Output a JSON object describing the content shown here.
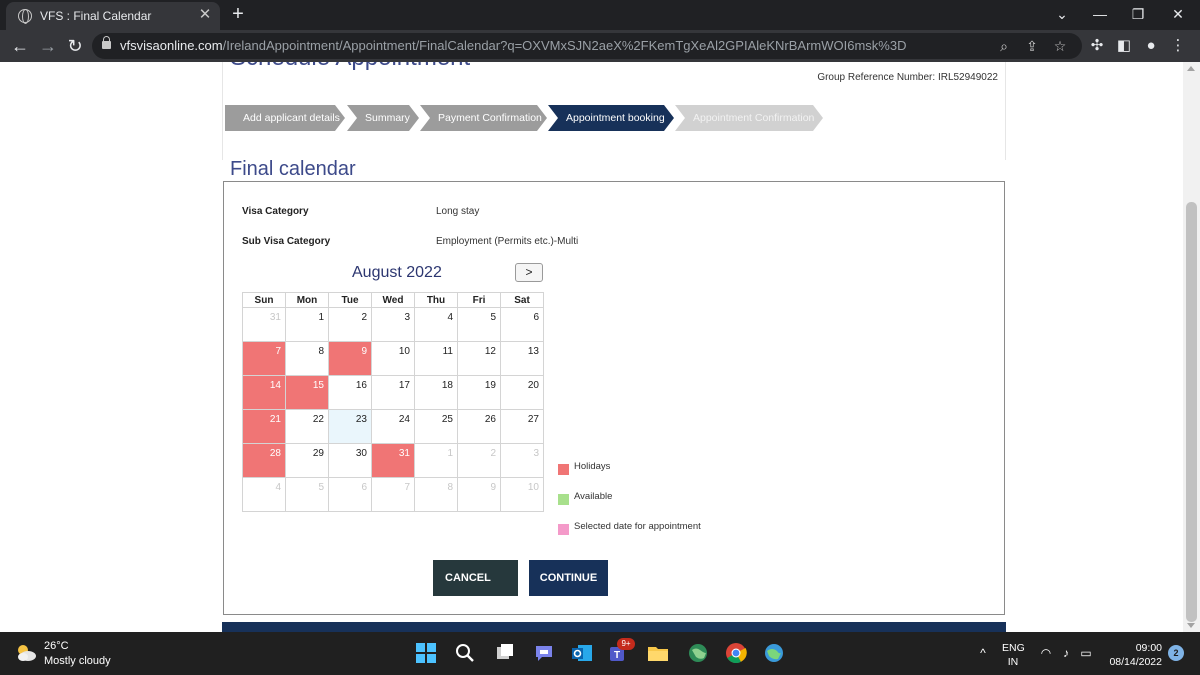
{
  "browser": {
    "tab_title": "VFS : Final Calendar",
    "tab_close": "✕",
    "new_tab": "+",
    "url_host": "vfsvisaonline.com",
    "url_path": "/IrelandAppointment/Appointment/FinalCalendar?q=OXVMxSJN2aeX%2FKemTgXeAl2GPIAleKNrBArmWOI6msk%3D"
  },
  "page": {
    "heading_partial": "Schedule Appointment",
    "group_reference": "Group Reference Number: IRL52949022",
    "steps": [
      {
        "label": "Add applicant details",
        "state": "done"
      },
      {
        "label": "Summary",
        "state": "done"
      },
      {
        "label": "Payment Confirmation",
        "state": "done"
      },
      {
        "label": "Appointment booking",
        "state": "active"
      },
      {
        "label": "Appointment Confirmation",
        "state": "pending"
      }
    ],
    "section_title": "Final calendar",
    "visa_category_label": "Visa Category",
    "visa_category_value": "Long stay",
    "sub_visa_category_label": "Sub Visa Category",
    "sub_visa_category_value": "Employment (Permits etc.)-Multi"
  },
  "calendar": {
    "month_title": "August 2022",
    "next_button": ">",
    "weekdays": [
      "Sun",
      "Mon",
      "Tue",
      "Wed",
      "Thu",
      "Fri",
      "Sat"
    ],
    "weeks": [
      [
        {
          "d": "31",
          "t": "other"
        },
        {
          "d": "1",
          "t": ""
        },
        {
          "d": "2",
          "t": ""
        },
        {
          "d": "3",
          "t": ""
        },
        {
          "d": "4",
          "t": ""
        },
        {
          "d": "5",
          "t": ""
        },
        {
          "d": "6",
          "t": ""
        }
      ],
      [
        {
          "d": "7",
          "t": "holiday"
        },
        {
          "d": "8",
          "t": ""
        },
        {
          "d": "9",
          "t": "holiday"
        },
        {
          "d": "10",
          "t": ""
        },
        {
          "d": "11",
          "t": ""
        },
        {
          "d": "12",
          "t": ""
        },
        {
          "d": "13",
          "t": ""
        }
      ],
      [
        {
          "d": "14",
          "t": "holiday"
        },
        {
          "d": "15",
          "t": "holiday"
        },
        {
          "d": "16",
          "t": ""
        },
        {
          "d": "17",
          "t": ""
        },
        {
          "d": "18",
          "t": ""
        },
        {
          "d": "19",
          "t": ""
        },
        {
          "d": "20",
          "t": ""
        }
      ],
      [
        {
          "d": "21",
          "t": "holiday"
        },
        {
          "d": "22",
          "t": ""
        },
        {
          "d": "23",
          "t": "today"
        },
        {
          "d": "24",
          "t": ""
        },
        {
          "d": "25",
          "t": ""
        },
        {
          "d": "26",
          "t": ""
        },
        {
          "d": "27",
          "t": ""
        }
      ],
      [
        {
          "d": "28",
          "t": "holiday"
        },
        {
          "d": "29",
          "t": ""
        },
        {
          "d": "30",
          "t": ""
        },
        {
          "d": "31",
          "t": "holiday"
        },
        {
          "d": "1",
          "t": "other"
        },
        {
          "d": "2",
          "t": "other"
        },
        {
          "d": "3",
          "t": "other"
        }
      ],
      [
        {
          "d": "4",
          "t": "other"
        },
        {
          "d": "5",
          "t": "other"
        },
        {
          "d": "6",
          "t": "other"
        },
        {
          "d": "7",
          "t": "other"
        },
        {
          "d": "8",
          "t": "other"
        },
        {
          "d": "9",
          "t": "other"
        },
        {
          "d": "10",
          "t": "other"
        }
      ]
    ]
  },
  "legend": {
    "holidays_label": "Holidays",
    "holidays_color": "#f07575",
    "available_label": "Available",
    "available_color": "#a8e08c",
    "selected_label": "Selected date for appointment",
    "selected_color": "#f49ac9"
  },
  "buttons": {
    "cancel": "CANCEL",
    "continue": "CONTINUE"
  },
  "taskbar": {
    "temperature": "26°C",
    "weather": "Mostly cloudy",
    "teams_badge": "9+",
    "lang_top": "ENG",
    "lang_bottom": "IN",
    "time": "09:00",
    "date": "08/14/2022",
    "notifications": "2"
  }
}
